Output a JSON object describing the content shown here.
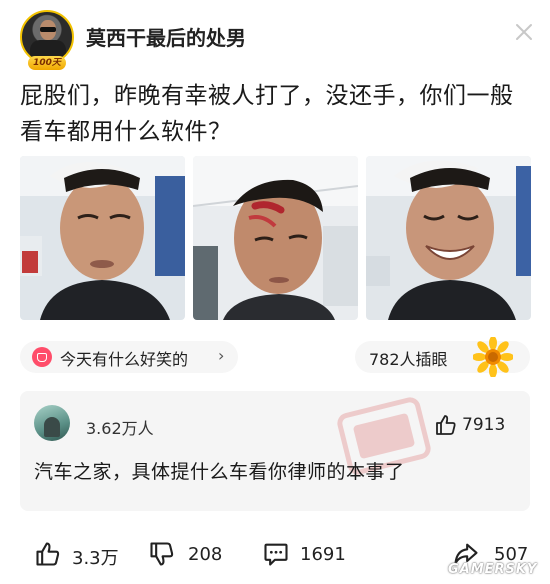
{
  "post": {
    "author": {
      "username": "莫西干最后的处男",
      "avatar_badge": "100天",
      "avatar": "avatar-man-sunglasses"
    },
    "close_icon": "close-icon",
    "question": "屁股们，昨晚有幸被人打了，没还手，你们一般看车都用什么软件？",
    "photos": [
      "photo-bandaged-selfie",
      "photo-forehead-wound",
      "photo-smiling-selfie"
    ]
  },
  "tags": {
    "topic_label": "今天有什么好笑的",
    "topic_chevron": "›",
    "insert_label": "782人插眼",
    "sunflower_icon": "sunflower-icon"
  },
  "top_comment": {
    "name": "3.62万人",
    "like_count": "7913",
    "text": "汽车之家，具体提什么车看你律师的本事了",
    "stamp_icon": "red-stamp-icon"
  },
  "actions": {
    "likes": "3.3万",
    "dislikes": "208",
    "comments": "1691",
    "shares": "507"
  },
  "watermark": "GAMERSKY",
  "colors": {
    "accent_pink": "#ff4d6a",
    "text_primary": "#1a1a1a",
    "card_bg": "#f5f5f5",
    "pill_bg": "#f6f6f6"
  }
}
